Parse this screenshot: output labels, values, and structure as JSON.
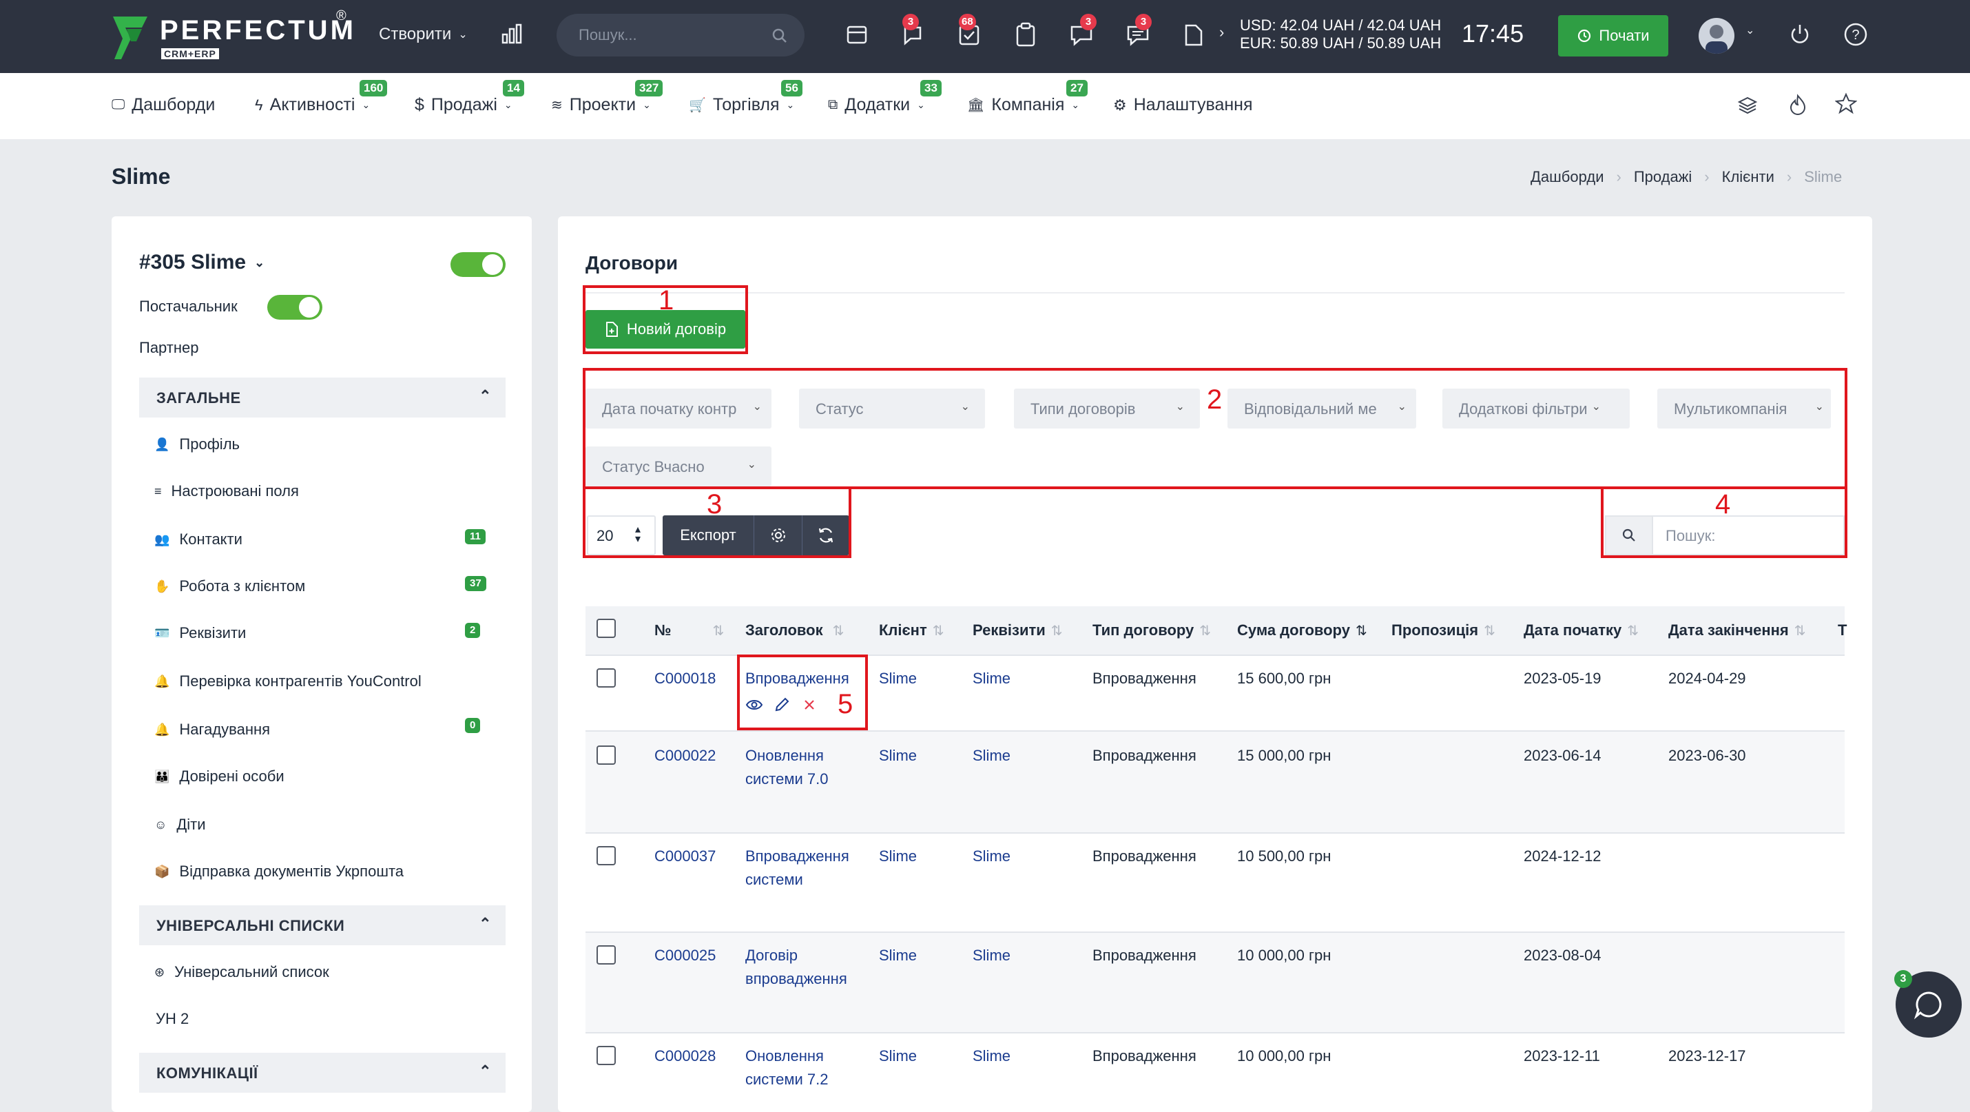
{
  "brand": {
    "name": "PERFECTUM",
    "registered": "®",
    "sub": "CRM+ERP"
  },
  "topbar": {
    "create_label": "Створити",
    "search_placeholder": "Пошук...",
    "badges": {
      "chat": "3",
      "tasks": "68",
      "messages": "3",
      "discussions": "3"
    },
    "rates": {
      "usd": "USD: 42.04 UAH / 42.04 UAH",
      "eur": "EUR: 50.89 UAH / 50.89 UAH"
    },
    "time": "17:45",
    "start_label": "Почати"
  },
  "nav": [
    {
      "label": "Дашборди",
      "badge": ""
    },
    {
      "label": "Активності",
      "badge": "160"
    },
    {
      "label": "Продажі",
      "badge": "14"
    },
    {
      "label": "Проекти",
      "badge": "327"
    },
    {
      "label": "Торгівля",
      "badge": "56"
    },
    {
      "label": "Додатки",
      "badge": "33"
    },
    {
      "label": "Компанія",
      "badge": "27"
    },
    {
      "label": "Налаштування",
      "badge": ""
    }
  ],
  "page": {
    "title": "Slime",
    "breadcrumb": [
      "Дашборди",
      "Продажі",
      "Клієнти",
      "Slime"
    ]
  },
  "sidebar": {
    "client_title": "#305 Slime",
    "supplier_label": "Постачальник",
    "partner_label": "Партнер",
    "sections": [
      {
        "title": "ЗАГАЛЬНЕ"
      },
      {
        "title": "УНІВЕРСАЛЬНІ СПИСКИ"
      },
      {
        "title": "КОМУНІКАЦІЇ"
      }
    ],
    "general_items": [
      {
        "label": "Профіль",
        "count": ""
      },
      {
        "label": "Настроювані поля",
        "count": ""
      },
      {
        "label": "Контакти",
        "count": "11"
      },
      {
        "label": "Робота з клієнтом",
        "count": "37"
      },
      {
        "label": "Реквізити",
        "count": "2"
      },
      {
        "label": "Перевірка контрагентів YouControl",
        "count": ""
      },
      {
        "label": "Нагадування",
        "count": "0"
      },
      {
        "label": "Довірені особи",
        "count": ""
      },
      {
        "label": "Діти",
        "count": ""
      },
      {
        "label": "Відправка документів Укрпошта",
        "count": ""
      }
    ],
    "universal_items": [
      {
        "label": "Універсальний список"
      },
      {
        "label": "УН 2"
      }
    ]
  },
  "main": {
    "title": "Договори",
    "new_contract_label": "Новий договір",
    "filters": [
      "Дата початку контр",
      "Статус",
      "Типи договорів",
      "Відповідальний ме",
      "Додаткові фільтри",
      "Мультикомпанія",
      "Статус Вчасно"
    ],
    "page_size": "20",
    "export_label": "Експорт",
    "search_placeholder": "Пошук:",
    "annotations": [
      "1",
      "2",
      "3",
      "4",
      "5"
    ],
    "table": {
      "headers": [
        "№",
        "Заголовок",
        "Клієнт",
        "Реквізити",
        "Тип договору",
        "Сума договору",
        "Пропозиція",
        "Дата початку",
        "Дата закінчення",
        "Т"
      ],
      "rows": [
        {
          "num": "C000018",
          "title": "Впровадження",
          "client": "Slime",
          "req": "Slime",
          "type": "Впровадження",
          "sum": "15 600,00 грн",
          "offer": "",
          "start": "2023-05-19",
          "end": "2024-04-29"
        },
        {
          "num": "C000022",
          "title": "Оновлення системи 7.0",
          "client": "Slime",
          "req": "Slime",
          "type": "Впровадження",
          "sum": "15 000,00 грн",
          "offer": "",
          "start": "2023-06-14",
          "end": "2023-06-30"
        },
        {
          "num": "C000037",
          "title": "Впровадження системи",
          "client": "Slime",
          "req": "Slime",
          "type": "Впровадження",
          "sum": "10 500,00 грн",
          "offer": "",
          "start": "2024-12-12",
          "end": ""
        },
        {
          "num": "C000025",
          "title": "Договір впровадження",
          "client": "Slime",
          "req": "Slime",
          "type": "Впровадження",
          "sum": "10 000,00 грн",
          "offer": "",
          "start": "2023-08-04",
          "end": ""
        },
        {
          "num": "C000028",
          "title": "Оновлення системи 7.2",
          "client": "Slime",
          "req": "Slime",
          "type": "Впровадження",
          "sum": "10 000,00 грн",
          "offer": "",
          "start": "2023-12-11",
          "end": "2023-12-17"
        }
      ]
    }
  },
  "chat_badge": "3",
  "colors": {
    "accent_green": "#2f9e44",
    "topbar": "#2d3340",
    "badge_red": "#e63a4c",
    "link": "#1b3c8f",
    "annotation_red": "#e0161d"
  }
}
